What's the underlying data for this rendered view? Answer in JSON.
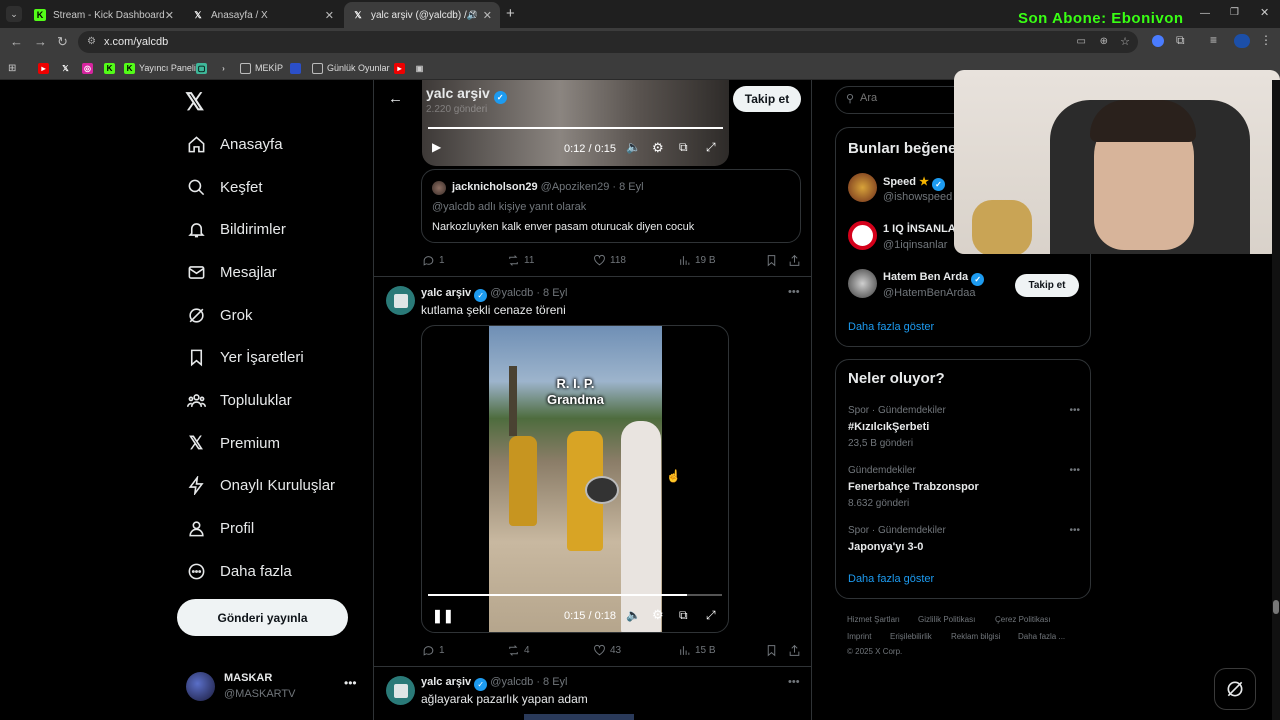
{
  "browser": {
    "tabs": [
      {
        "title": "Stream - Kick Dashboard",
        "icon": "kick-icon"
      },
      {
        "title": "Anasayfa / X",
        "icon": "x-icon"
      },
      {
        "title": "yalc arşiv (@yalcdb) / X",
        "icon": "x-icon"
      }
    ],
    "url": "x.com/yalcdb",
    "bookmarks": [
      "Yayıncı Paneli",
      "MEKİP",
      "Günlük Oyunlar"
    ]
  },
  "overlay": {
    "stream_text": "Son Abone: Ebonivon"
  },
  "sidebar": {
    "items": [
      {
        "label": "Anasayfa",
        "icon": "home-icon"
      },
      {
        "label": "Keşfet",
        "icon": "search-icon"
      },
      {
        "label": "Bildirimler",
        "icon": "bell-icon"
      },
      {
        "label": "Mesajlar",
        "icon": "mail-icon"
      },
      {
        "label": "Grok",
        "icon": "grok-icon"
      },
      {
        "label": "Yer İşaretleri",
        "icon": "bookmark-icon"
      },
      {
        "label": "Topluluklar",
        "icon": "people-icon"
      },
      {
        "label": "Premium",
        "icon": "x-icon"
      },
      {
        "label": "Onaylı Kuruluşlar",
        "icon": "lightning-icon"
      },
      {
        "label": "Profil",
        "icon": "person-icon"
      },
      {
        "label": "Daha fazla",
        "icon": "more-circle-icon"
      }
    ],
    "post_button": "Gönderi yayınla",
    "account": {
      "name": "MASKAR",
      "handle": "@MASKARTV"
    }
  },
  "header": {
    "name": "yalc arşiv",
    "post_count": "2.220 gönderi",
    "follow": "Takip et"
  },
  "video1": {
    "time": "0:12 / 0:15"
  },
  "quoted": {
    "name": "jacknicholson29",
    "handle": "@Apoziken29",
    "date": "8 Eyl",
    "reply_to": "@yalcdb adlı kişiye yanıt olarak",
    "text": "Narkozluyken kalk enver pasam oturucak diyen cocuk"
  },
  "tweet1_stats": {
    "replies": "1",
    "retweets": "11",
    "likes": "118",
    "views": "19 B"
  },
  "tweet2": {
    "name": "yalc arşiv",
    "handle": "@yalcdb",
    "date": "8 Eyl",
    "text": "kutlama şekli cenaze töreni",
    "overlay_text1": "R. I. P.",
    "overlay_text2": "Grandma",
    "time": "0:15 / 0:18",
    "progress": 0.88,
    "stats": {
      "replies": "1",
      "retweets": "4",
      "likes": "43",
      "views": "15 B"
    }
  },
  "tweet3": {
    "name": "yalc arşiv",
    "handle": "@yalcdb",
    "date": "8 Eyl",
    "text": "ağlayarak pazarlık yapan adam"
  },
  "right": {
    "search_placeholder": "Ara",
    "who_to_follow_title": "Bunları beğene",
    "suggestions": [
      {
        "name": "Speed",
        "handle": "@ishowspeed"
      },
      {
        "name": "1 IQ İNSANLA",
        "handle": "@1iqinsanlar"
      },
      {
        "name": "Hatem Ben Arda",
        "handle": "@HatemBenArdaa",
        "follow": "Takip et"
      }
    ],
    "show_more": "Daha fazla göster",
    "trends_title": "Neler oluyor?",
    "trends": [
      {
        "category": "Spor · Gündemdekiler",
        "name": "#KızılcıkŞerbeti",
        "count": "23,5 B gönderi"
      },
      {
        "category": "Gündemdekiler",
        "name": "Fenerbahçe Trabzonspor",
        "count": "8.632 gönderi"
      },
      {
        "category": "Spor · Gündemdekiler",
        "name": "Japonya'yı 3-0",
        "count": ""
      }
    ],
    "trends_more": "Daha fazla göster",
    "footer": [
      "Hizmet Şartları",
      "Gizlilik Politikası",
      "Çerez Politikası",
      "Imprint",
      "Erişilebilirlik",
      "Reklam bilgisi",
      "Daha fazla ...",
      "© 2025 X Corp."
    ]
  },
  "colors": {
    "accent": "#1d9bf0",
    "stream_text": "#39ff14",
    "kick": "#53fc18"
  }
}
